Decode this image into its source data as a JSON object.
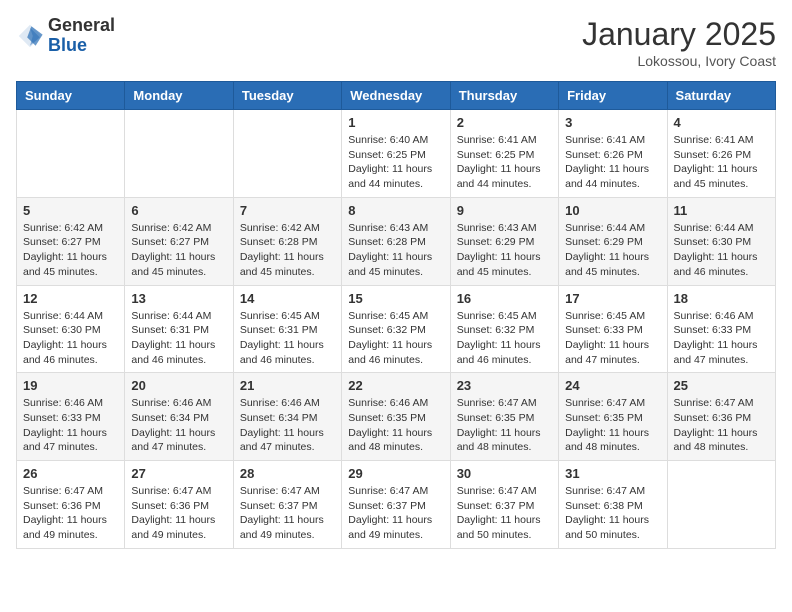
{
  "header": {
    "logo_line1": "General",
    "logo_line2": "Blue",
    "month": "January 2025",
    "location": "Lokossou, Ivory Coast"
  },
  "weekdays": [
    "Sunday",
    "Monday",
    "Tuesday",
    "Wednesday",
    "Thursday",
    "Friday",
    "Saturday"
  ],
  "weeks": [
    [
      {
        "day": "",
        "info": ""
      },
      {
        "day": "",
        "info": ""
      },
      {
        "day": "",
        "info": ""
      },
      {
        "day": "1",
        "info": "Sunrise: 6:40 AM\nSunset: 6:25 PM\nDaylight: 11 hours and 44 minutes."
      },
      {
        "day": "2",
        "info": "Sunrise: 6:41 AM\nSunset: 6:25 PM\nDaylight: 11 hours and 44 minutes."
      },
      {
        "day": "3",
        "info": "Sunrise: 6:41 AM\nSunset: 6:26 PM\nDaylight: 11 hours and 44 minutes."
      },
      {
        "day": "4",
        "info": "Sunrise: 6:41 AM\nSunset: 6:26 PM\nDaylight: 11 hours and 45 minutes."
      }
    ],
    [
      {
        "day": "5",
        "info": "Sunrise: 6:42 AM\nSunset: 6:27 PM\nDaylight: 11 hours and 45 minutes."
      },
      {
        "day": "6",
        "info": "Sunrise: 6:42 AM\nSunset: 6:27 PM\nDaylight: 11 hours and 45 minutes."
      },
      {
        "day": "7",
        "info": "Sunrise: 6:42 AM\nSunset: 6:28 PM\nDaylight: 11 hours and 45 minutes."
      },
      {
        "day": "8",
        "info": "Sunrise: 6:43 AM\nSunset: 6:28 PM\nDaylight: 11 hours and 45 minutes."
      },
      {
        "day": "9",
        "info": "Sunrise: 6:43 AM\nSunset: 6:29 PM\nDaylight: 11 hours and 45 minutes."
      },
      {
        "day": "10",
        "info": "Sunrise: 6:44 AM\nSunset: 6:29 PM\nDaylight: 11 hours and 45 minutes."
      },
      {
        "day": "11",
        "info": "Sunrise: 6:44 AM\nSunset: 6:30 PM\nDaylight: 11 hours and 46 minutes."
      }
    ],
    [
      {
        "day": "12",
        "info": "Sunrise: 6:44 AM\nSunset: 6:30 PM\nDaylight: 11 hours and 46 minutes."
      },
      {
        "day": "13",
        "info": "Sunrise: 6:44 AM\nSunset: 6:31 PM\nDaylight: 11 hours and 46 minutes."
      },
      {
        "day": "14",
        "info": "Sunrise: 6:45 AM\nSunset: 6:31 PM\nDaylight: 11 hours and 46 minutes."
      },
      {
        "day": "15",
        "info": "Sunrise: 6:45 AM\nSunset: 6:32 PM\nDaylight: 11 hours and 46 minutes."
      },
      {
        "day": "16",
        "info": "Sunrise: 6:45 AM\nSunset: 6:32 PM\nDaylight: 11 hours and 46 minutes."
      },
      {
        "day": "17",
        "info": "Sunrise: 6:45 AM\nSunset: 6:33 PM\nDaylight: 11 hours and 47 minutes."
      },
      {
        "day": "18",
        "info": "Sunrise: 6:46 AM\nSunset: 6:33 PM\nDaylight: 11 hours and 47 minutes."
      }
    ],
    [
      {
        "day": "19",
        "info": "Sunrise: 6:46 AM\nSunset: 6:33 PM\nDaylight: 11 hours and 47 minutes."
      },
      {
        "day": "20",
        "info": "Sunrise: 6:46 AM\nSunset: 6:34 PM\nDaylight: 11 hours and 47 minutes."
      },
      {
        "day": "21",
        "info": "Sunrise: 6:46 AM\nSunset: 6:34 PM\nDaylight: 11 hours and 47 minutes."
      },
      {
        "day": "22",
        "info": "Sunrise: 6:46 AM\nSunset: 6:35 PM\nDaylight: 11 hours and 48 minutes."
      },
      {
        "day": "23",
        "info": "Sunrise: 6:47 AM\nSunset: 6:35 PM\nDaylight: 11 hours and 48 minutes."
      },
      {
        "day": "24",
        "info": "Sunrise: 6:47 AM\nSunset: 6:35 PM\nDaylight: 11 hours and 48 minutes."
      },
      {
        "day": "25",
        "info": "Sunrise: 6:47 AM\nSunset: 6:36 PM\nDaylight: 11 hours and 48 minutes."
      }
    ],
    [
      {
        "day": "26",
        "info": "Sunrise: 6:47 AM\nSunset: 6:36 PM\nDaylight: 11 hours and 49 minutes."
      },
      {
        "day": "27",
        "info": "Sunrise: 6:47 AM\nSunset: 6:36 PM\nDaylight: 11 hours and 49 minutes."
      },
      {
        "day": "28",
        "info": "Sunrise: 6:47 AM\nSunset: 6:37 PM\nDaylight: 11 hours and 49 minutes."
      },
      {
        "day": "29",
        "info": "Sunrise: 6:47 AM\nSunset: 6:37 PM\nDaylight: 11 hours and 49 minutes."
      },
      {
        "day": "30",
        "info": "Sunrise: 6:47 AM\nSunset: 6:37 PM\nDaylight: 11 hours and 50 minutes."
      },
      {
        "day": "31",
        "info": "Sunrise: 6:47 AM\nSunset: 6:38 PM\nDaylight: 11 hours and 50 minutes."
      },
      {
        "day": "",
        "info": ""
      }
    ]
  ]
}
